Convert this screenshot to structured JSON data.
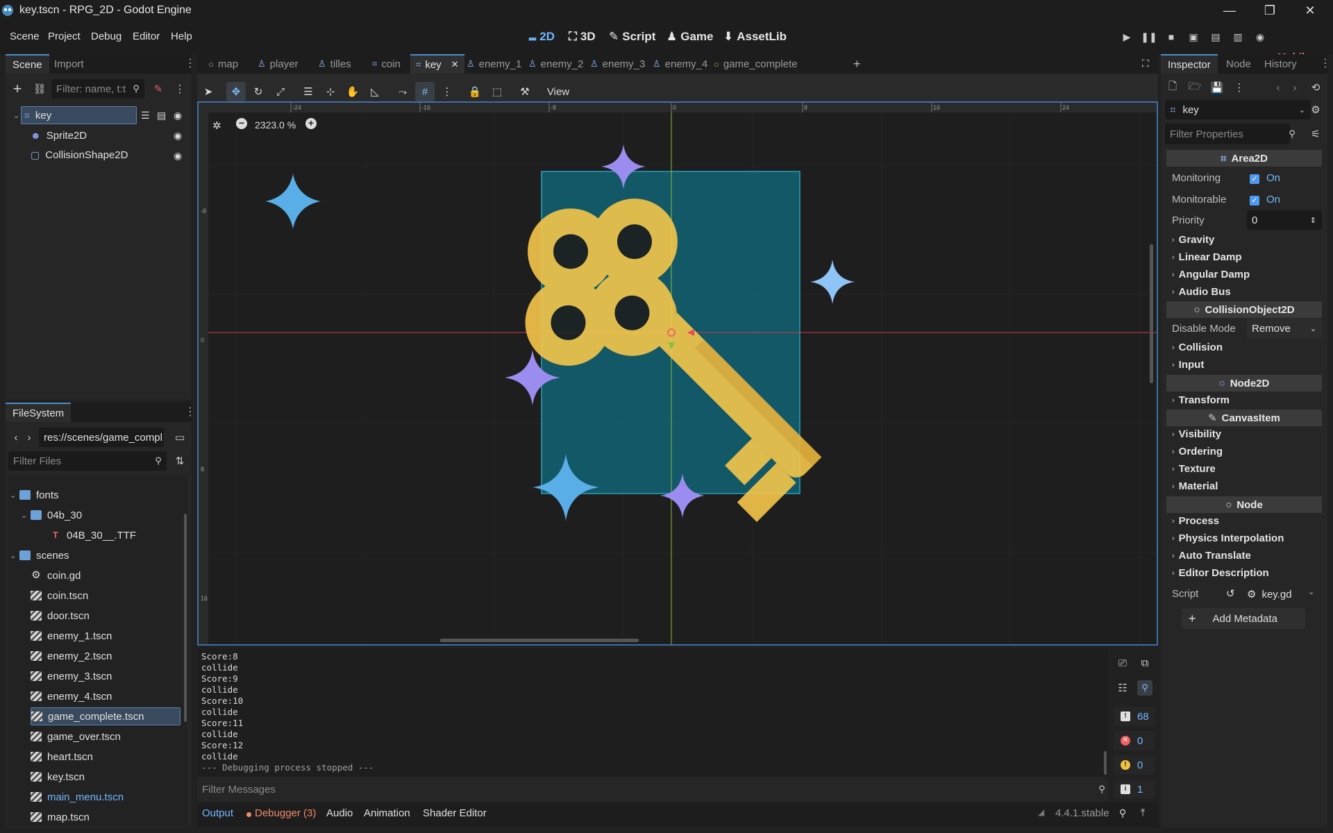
{
  "window": {
    "title": "key.tscn - RPG_2D - Godot Engine",
    "minimize": "—",
    "maximize": "❐",
    "close": "✕"
  },
  "menu": [
    "Scene",
    "Project",
    "Debug",
    "Editor",
    "Help"
  ],
  "workspaces": [
    {
      "icon": "⑉",
      "label": "2D"
    },
    {
      "icon": "⛶",
      "label": "3D"
    },
    {
      "icon": "✎",
      "label": "Script"
    },
    {
      "icon": "♟",
      "label": "Game"
    },
    {
      "icon": "⬇",
      "label": "AssetLib"
    }
  ],
  "renderer": "Mobile",
  "scene_dock": {
    "tabs": [
      "Scene",
      "Import"
    ],
    "filter_placeholder": "Filter: name, t:t",
    "nodes": [
      {
        "name": "key",
        "type": "Area2D"
      },
      {
        "name": "Sprite2D"
      },
      {
        "name": "CollisionShape2D"
      }
    ]
  },
  "filesystem": {
    "tab": "FileSystem",
    "path": "res://scenes/game_compl",
    "filter_placeholder": "Filter Files",
    "items": [
      {
        "name": "fonts",
        "kind": "folder",
        "depth": 0
      },
      {
        "name": "04b_30",
        "kind": "folder",
        "depth": 1
      },
      {
        "name": "04B_30__.TTF",
        "kind": "font",
        "depth": 2
      },
      {
        "name": "scenes",
        "kind": "folder",
        "depth": 0
      },
      {
        "name": "coin.gd",
        "kind": "script",
        "depth": 1
      },
      {
        "name": "coin.tscn",
        "kind": "scene",
        "depth": 1
      },
      {
        "name": "door.tscn",
        "kind": "scene",
        "depth": 1
      },
      {
        "name": "enemy_1.tscn",
        "kind": "scene",
        "depth": 1
      },
      {
        "name": "enemy_2.tscn",
        "kind": "scene",
        "depth": 1
      },
      {
        "name": "enemy_3.tscn",
        "kind": "scene",
        "depth": 1
      },
      {
        "name": "enemy_4.tscn",
        "kind": "scene",
        "depth": 1
      },
      {
        "name": "game_complete.tscn",
        "kind": "scene",
        "depth": 1,
        "selected": true
      },
      {
        "name": "game_over.tscn",
        "kind": "scene",
        "depth": 1
      },
      {
        "name": "heart.tscn",
        "kind": "scene",
        "depth": 1
      },
      {
        "name": "key.tscn",
        "kind": "scene",
        "depth": 1
      },
      {
        "name": "main_menu.tscn",
        "kind": "scene",
        "depth": 1,
        "highlight": true
      },
      {
        "name": "map.tscn",
        "kind": "scene",
        "depth": 1
      }
    ]
  },
  "scene_tabs": [
    {
      "label": "map",
      "icon": "○"
    },
    {
      "label": "player",
      "icon": "♙"
    },
    {
      "label": "tilles",
      "icon": "♙"
    },
    {
      "label": "coin",
      "icon": "⌗"
    },
    {
      "label": "key",
      "icon": "⌗",
      "active": true
    },
    {
      "label": "enemy_1",
      "icon": "♙"
    },
    {
      "label": "enemy_2",
      "icon": "♙"
    },
    {
      "label": "enemy_3",
      "icon": "♙"
    },
    {
      "label": "enemy_4",
      "icon": "♙"
    },
    {
      "label": "game_complete",
      "icon": "○"
    }
  ],
  "toolbar": {
    "view_label": "View"
  },
  "viewport": {
    "zoom": "2323.0 %",
    "ruler_labels": [
      "-24",
      "-16",
      "-8",
      "0",
      "8",
      "16",
      "24"
    ],
    "vruler_labels": [
      "-8",
      "0",
      "8",
      "16"
    ]
  },
  "output": {
    "lines": [
      "Score:8",
      "collide",
      "Score:9",
      "collide",
      "Score:10",
      "collide",
      "Score:11",
      "collide",
      "Score:12",
      "collide",
      "--- Debugging process stopped ---"
    ],
    "filter_placeholder": "Filter Messages",
    "counts": {
      "messages": "68",
      "errors": "0",
      "warnings": "0",
      "info": "1"
    }
  },
  "bottom_tabs": [
    "Output",
    "Debugger (3)",
    "Audio",
    "Animation",
    "Shader Editor"
  ],
  "version": "4.4.1.stable",
  "inspector": {
    "tabs": [
      "Inspector",
      "Node",
      "History"
    ],
    "object": "key",
    "filter_placeholder": "Filter Properties",
    "sections": {
      "area2d": "Area2D",
      "collision_object": "CollisionObject2D",
      "node2d": "Node2D",
      "canvas_item": "CanvasItem",
      "node": "Node"
    },
    "props": {
      "monitoring": {
        "label": "Monitoring",
        "value": "On"
      },
      "monitorable": {
        "label": "Monitorable",
        "value": "On"
      },
      "priority": {
        "label": "Priority",
        "value": "0"
      },
      "disable_mode": {
        "label": "Disable Mode",
        "value": "Remove"
      },
      "script": {
        "label": "Script",
        "value": "key.gd"
      }
    },
    "cats_area": [
      "Gravity",
      "Linear Damp",
      "Angular Damp",
      "Audio Bus"
    ],
    "cats_col": [
      "Collision",
      "Input"
    ],
    "cats_n2d": [
      "Transform"
    ],
    "cats_ci": [
      "Visibility",
      "Ordering",
      "Texture",
      "Material"
    ],
    "cats_node": [
      "Process",
      "Physics Interpolation",
      "Auto Translate",
      "Editor Description"
    ],
    "add_metadata": "Add Metadata"
  },
  "colors": {
    "accent": "#70b8ff",
    "collision": "#0f8fa8",
    "x_axis": "#c83c4c",
    "y_axis": "#88c040"
  }
}
